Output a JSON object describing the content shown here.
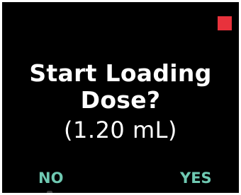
{
  "colors": {
    "background": "#000000",
    "text": "#ffffff",
    "softkey": "#6fc9b2",
    "indicator": "#e8323c"
  },
  "indicator": {
    "icon": "red-square-indicator-icon"
  },
  "prompt": {
    "line1": "Start Loading",
    "line2": "Dose?",
    "volume": "(1.20 mL)"
  },
  "softkeys": {
    "left": "NO",
    "right": "YES"
  }
}
